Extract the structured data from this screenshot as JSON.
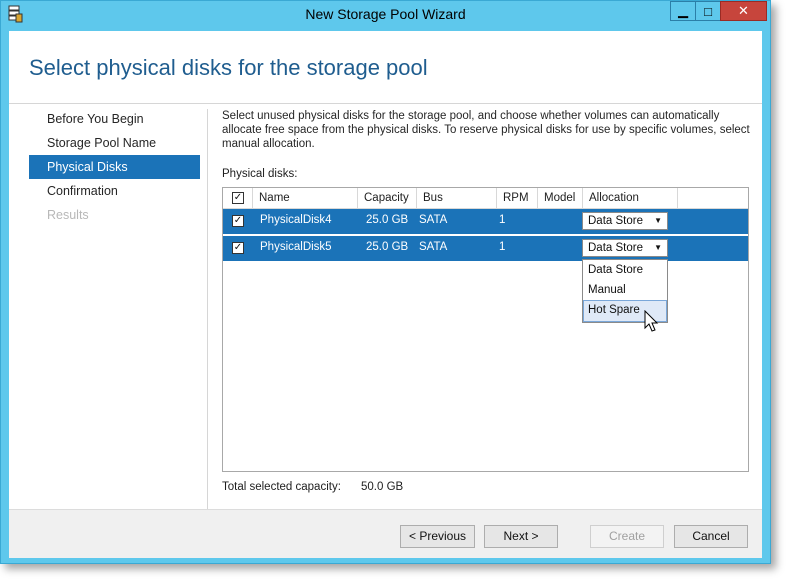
{
  "window": {
    "title": "New Storage Pool Wizard",
    "controls": {
      "minimize": "▁",
      "maximize": "□",
      "close": "✕"
    }
  },
  "page": {
    "heading": "Select physical disks for the storage pool"
  },
  "nav": [
    {
      "label": "Before You Begin",
      "state": "normal"
    },
    {
      "label": "Storage Pool Name",
      "state": "normal"
    },
    {
      "label": "Physical Disks",
      "state": "active"
    },
    {
      "label": "Confirmation",
      "state": "normal"
    },
    {
      "label": "Results",
      "state": "disabled"
    }
  ],
  "content": {
    "description": "Select unused physical disks for the storage pool, and choose whether volumes can automatically allocate free space from the physical disks. To reserve physical disks for use by specific volumes, select manual allocation.",
    "disks_label": "Physical disks:",
    "columns": [
      "Name",
      "Capacity",
      "Bus",
      "RPM",
      "Model",
      "Allocation"
    ],
    "rows": [
      {
        "checked": true,
        "name": "PhysicalDisk4",
        "capacity": "25.0 GB",
        "bus": "SATA",
        "rpm": "1",
        "model": "",
        "allocation": "Data Store"
      },
      {
        "checked": true,
        "name": "PhysicalDisk5",
        "capacity": "25.0 GB",
        "bus": "SATA",
        "rpm": "1",
        "model": "",
        "allocation": "Data Store"
      }
    ],
    "allocation_options": [
      "Data Store",
      "Manual",
      "Hot Spare"
    ],
    "hovered_option": "Hot Spare",
    "total_label": "Total selected capacity:",
    "total_value": "50.0 GB"
  },
  "buttons": {
    "previous": "< Previous",
    "next": "Next >",
    "create": "Create",
    "cancel": "Cancel"
  },
  "colors": {
    "accent": "#1b73b8",
    "titlebar": "#5ec8ec",
    "close": "#c7453c",
    "heading": "#1f5d8f"
  }
}
